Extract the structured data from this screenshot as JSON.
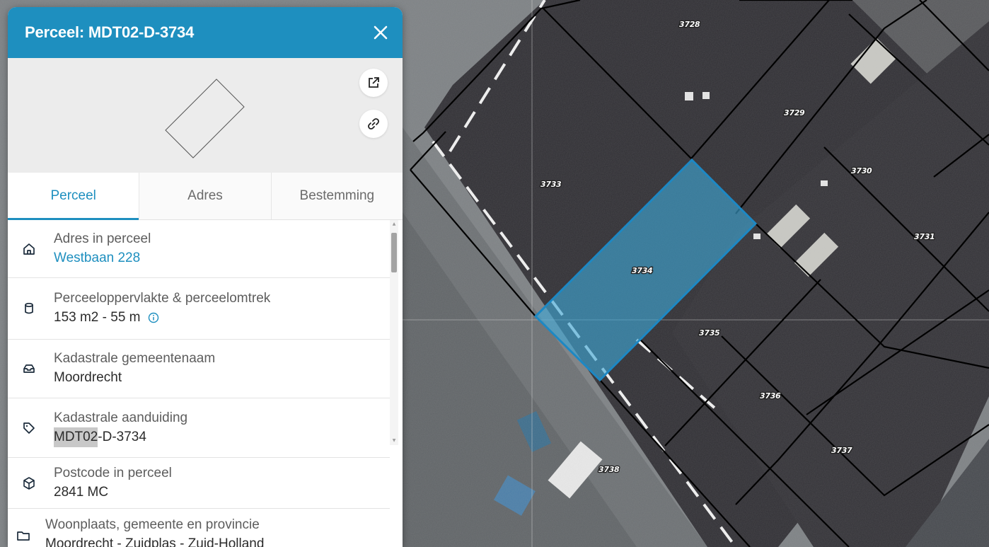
{
  "panel": {
    "title": "Perceel: MDT02-D-3734",
    "close_icon": "close-icon",
    "open_external_icon": "external-link-icon",
    "share_link_icon": "link-icon"
  },
  "tabs": [
    {
      "label": "Perceel",
      "active": true
    },
    {
      "label": "Adres",
      "active": false
    },
    {
      "label": "Bestemming",
      "active": false
    }
  ],
  "details": [
    {
      "icon": "home-icon",
      "label": "Adres in perceel",
      "value": "Westbaan 228",
      "is_link": true
    },
    {
      "icon": "cylinder-icon",
      "label": "Perceeloppervlakte & perceelomtrek",
      "value": "153 m2 - 55 m",
      "info_icon": "info-icon"
    },
    {
      "icon": "inbox-icon",
      "label": "Kadastrale gemeentenaam",
      "value": "Moordrecht"
    },
    {
      "icon": "tag-icon",
      "label": "Kadastrale aanduiding",
      "value_highlight": "MDT02",
      "value_rest": "-D-3734"
    },
    {
      "icon": "box-icon",
      "label": "Postcode in perceel",
      "value": "2841 MC"
    },
    {
      "icon": "folder-icon",
      "label": "Woonplaats, gemeente en provincie",
      "value": "Moordrecht - Zuidplas - Zuid-Holland"
    }
  ],
  "map": {
    "parcel_numbers": [
      "3728",
      "3729",
      "3730",
      "3731",
      "3733",
      "3734",
      "3735",
      "3736",
      "3737",
      "3738"
    ],
    "selected_parcel": "3734",
    "colors": {
      "header": "#1e8fbf",
      "selection_fill": "#3fa8d6",
      "parcel_line": "#000000",
      "roof": "#2f2e33"
    }
  }
}
